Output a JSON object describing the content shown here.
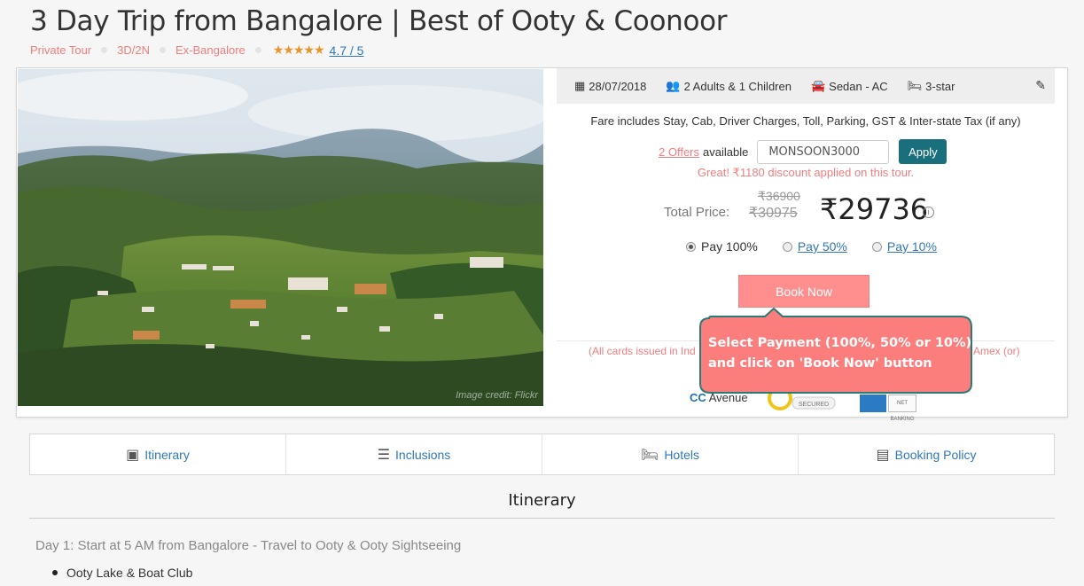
{
  "header": {
    "title": "3 Day Trip from Bangalore | Best of Ooty & Coonoor",
    "tags": [
      "Private Tour",
      "3D/2N",
      "Ex-Bangalore"
    ],
    "stars": "★★★★★",
    "rating": "4.7 / 5",
    "rating_value": 4.7
  },
  "photo": {
    "credit": "Image credit: Flickr"
  },
  "trip_info": {
    "date": "28/07/2018",
    "travellers": "2 Adults & 1 Children",
    "car": "Sedan - AC",
    "hotel": "3-star"
  },
  "pricing": {
    "fare_note": "Fare includes Stay, Cab, Driver Charges, Toll, Parking, GST & Inter-state Tax (if any)",
    "offers_link": "2 Offers",
    "offers_suffix": "available",
    "coupon_value": "MONSOON3000",
    "apply_label": "Apply",
    "discount_msg": "Great! ₹1180 discount applied on this tour.",
    "total_label": "Total Price:",
    "old_price_1": "₹36900",
    "old_price_2": "₹30975",
    "new_price": "₹29736",
    "pay_options": [
      {
        "label": "Pay 100%",
        "selected": true
      },
      {
        "label": "Pay 50%",
        "selected": false
      },
      {
        "label": "Pay 10%",
        "selected": false
      }
    ],
    "book_label": "Book Now",
    "cards_note_left": "(All cards issued in Ind",
    "cards_note_right": "Amex (or)",
    "ccavenue_cc": "CC",
    "ccavenue_text": "Avenue",
    "secured_text": "SECURED",
    "netbanking_text": "NET BANKING"
  },
  "callout": {
    "text_line1": "Select Payment (100%, 50% or 10%)",
    "text_line2": "and click on 'Book Now' button",
    "fill": "#fb7d7c",
    "border": "#2c7a76"
  },
  "tabs": [
    {
      "label": "Itinerary"
    },
    {
      "label": "Inclusions"
    },
    {
      "label": "Hotels"
    },
    {
      "label": "Booking Policy"
    }
  ],
  "itinerary": {
    "section_title": "Itinerary",
    "day1_title": "Day 1: Start at 5 AM from Bangalore - Travel to Ooty & Ooty Sightseeing",
    "day1_items": [
      "Ooty Lake & Boat Club"
    ]
  }
}
